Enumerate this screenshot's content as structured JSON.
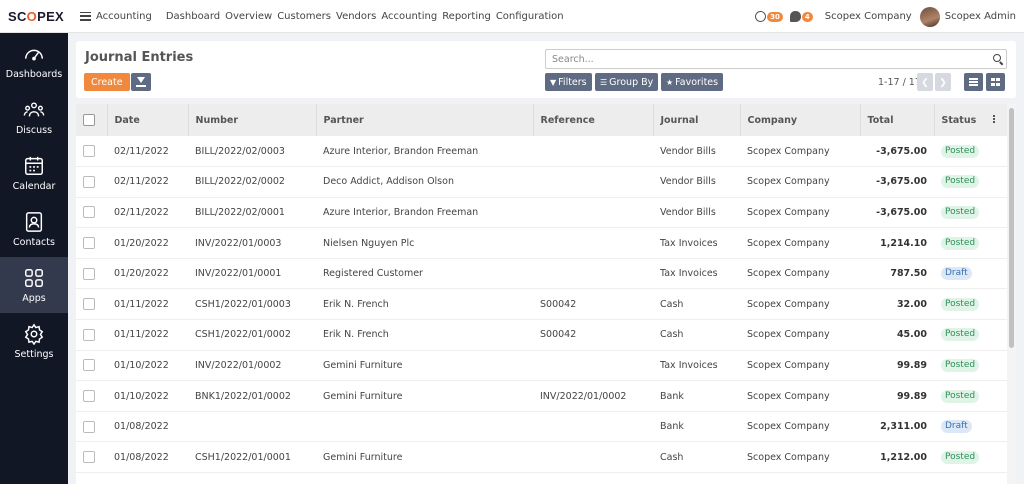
{
  "brand": {
    "prefix": "SC",
    "accent": "O",
    "suffix": "PEX"
  },
  "topbar": {
    "app": "Accounting",
    "menu": [
      "Dashboard",
      "Overview",
      "Customers",
      "Vendors",
      "Accounting",
      "Reporting",
      "Configuration"
    ],
    "activity_count": "30",
    "message_count": "4",
    "company": "Scopex Company",
    "user": "Scopex Admin"
  },
  "sidebar": {
    "items": [
      {
        "label": "Dashboards",
        "icon": "gauge-icon"
      },
      {
        "label": "Discuss",
        "icon": "people-icon"
      },
      {
        "label": "Calendar",
        "icon": "calendar-icon"
      },
      {
        "label": "Contacts",
        "icon": "contact-icon"
      },
      {
        "label": "Apps",
        "icon": "grid-icon"
      },
      {
        "label": "Settings",
        "icon": "gear-icon"
      }
    ],
    "active_index": 4
  },
  "control": {
    "title": "Journal Entries",
    "create_label": "Create",
    "search_placeholder": "Search...",
    "filters_label": "Filters",
    "groupby_label": "Group By",
    "favorites_label": "Favorites",
    "pager": "1-17 / 17"
  },
  "table": {
    "columns": [
      "Date",
      "Number",
      "Partner",
      "Reference",
      "Journal",
      "Company",
      "Total",
      "Status"
    ],
    "rows": [
      {
        "date": "02/11/2022",
        "number": "BILL/2022/02/0003",
        "partner": "Azure Interior, Brandon Freeman",
        "reference": "",
        "journal": "Vendor Bills",
        "company": "Scopex Company",
        "total": "-3,675.00",
        "status": "Posted"
      },
      {
        "date": "02/11/2022",
        "number": "BILL/2022/02/0002",
        "partner": "Deco Addict, Addison Olson",
        "reference": "",
        "journal": "Vendor Bills",
        "company": "Scopex Company",
        "total": "-3,675.00",
        "status": "Posted"
      },
      {
        "date": "02/11/2022",
        "number": "BILL/2022/02/0001",
        "partner": "Azure Interior, Brandon Freeman",
        "reference": "",
        "journal": "Vendor Bills",
        "company": "Scopex Company",
        "total": "-3,675.00",
        "status": "Posted"
      },
      {
        "date": "01/20/2022",
        "number": "INV/2022/01/0003",
        "partner": "Nielsen Nguyen Plc",
        "reference": "",
        "journal": "Tax Invoices",
        "company": "Scopex Company",
        "total": "1,214.10",
        "status": "Posted"
      },
      {
        "date": "01/20/2022",
        "number": "INV/2022/01/0001",
        "partner": "Registered Customer",
        "reference": "",
        "journal": "Tax Invoices",
        "company": "Scopex Company",
        "total": "787.50",
        "status": "Draft"
      },
      {
        "date": "01/11/2022",
        "number": "CSH1/2022/01/0003",
        "partner": "Erik N. French",
        "reference": "S00042",
        "journal": "Cash",
        "company": "Scopex Company",
        "total": "32.00",
        "status": "Posted"
      },
      {
        "date": "01/11/2022",
        "number": "CSH1/2022/01/0002",
        "partner": "Erik N. French",
        "reference": "S00042",
        "journal": "Cash",
        "company": "Scopex Company",
        "total": "45.00",
        "status": "Posted"
      },
      {
        "date": "01/10/2022",
        "number": "INV/2022/01/0002",
        "partner": "Gemini Furniture",
        "reference": "",
        "journal": "Tax Invoices",
        "company": "Scopex Company",
        "total": "99.89",
        "status": "Posted"
      },
      {
        "date": "01/10/2022",
        "number": "BNK1/2022/01/0002",
        "partner": "Gemini Furniture",
        "reference": "INV/2022/01/0002",
        "journal": "Bank",
        "company": "Scopex Company",
        "total": "99.89",
        "status": "Posted"
      },
      {
        "date": "01/08/2022",
        "number": "",
        "partner": "",
        "reference": "",
        "journal": "Bank",
        "company": "Scopex Company",
        "total": "2,311.00",
        "status": "Draft"
      },
      {
        "date": "01/08/2022",
        "number": "CSH1/2022/01/0001",
        "partner": "Gemini Furniture",
        "reference": "",
        "journal": "Cash",
        "company": "Scopex Company",
        "total": "1,212.00",
        "status": "Posted"
      }
    ]
  },
  "colors": {
    "accent": "#f0883e",
    "sidebar": "#121726",
    "sidebar_active": "#343a4d",
    "button": "#5f6b82"
  }
}
